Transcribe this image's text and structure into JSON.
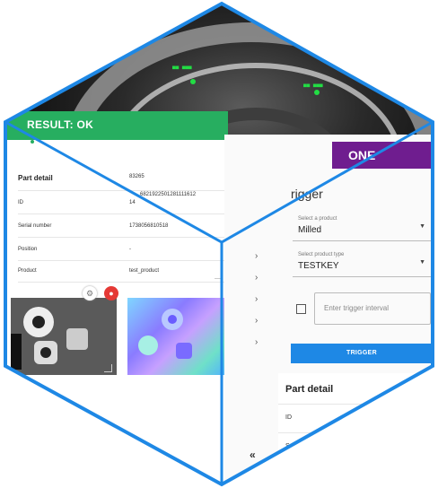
{
  "left_panel": {
    "result": "RESULT: OK",
    "part_detail_title": "Part detail",
    "part_detail_value": "83265",
    "rows": [
      {
        "key": "ID",
        "value": "14"
      },
      {
        "key": "Serial number",
        "value": "1738056810518"
      },
      {
        "key": "Position",
        "value": "-"
      },
      {
        "key": "Product",
        "value": "test_product"
      }
    ],
    "id_extra": "6821922501281111612"
  },
  "right_panel": {
    "banner_suffix": "ONE",
    "trigger_title": "rigger",
    "product_select": {
      "label": "Select a product",
      "value": "Milled"
    },
    "type_select": {
      "label": "Select product type",
      "value": "TESTKEY"
    },
    "interval_placeholder": "Enter trigger interval",
    "trigger_button": "TRIGGER",
    "part_detail_title": "Part detail",
    "id_label": "ID",
    "serial_partial": "Se",
    "collapse": "«"
  },
  "icons": {
    "gear": "gear-icon",
    "record": "record-icon",
    "chevron": "chevron-right-icon"
  },
  "colors": {
    "ok_green": "#27ae60",
    "trigger_blue": "#1e88e5",
    "brand_purple": "#6f1d8f",
    "hex_border": "#1e88e5"
  }
}
